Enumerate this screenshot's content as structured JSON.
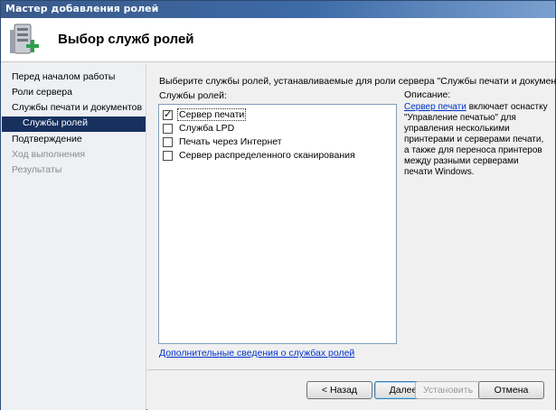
{
  "window": {
    "title": "Мастер добавления ролей"
  },
  "header": {
    "title": "Выбор служб ролей",
    "icon": "server-add-icon"
  },
  "nav": {
    "items": [
      {
        "label": "Перед началом работы",
        "state": "normal"
      },
      {
        "label": "Роли сервера",
        "state": "normal"
      },
      {
        "label": "Службы печати и документов",
        "state": "normal"
      },
      {
        "label": "Службы ролей",
        "state": "active"
      },
      {
        "label": "Подтверждение",
        "state": "normal"
      },
      {
        "label": "Ход выполнения",
        "state": "disabled"
      },
      {
        "label": "Результаты",
        "state": "disabled"
      }
    ]
  },
  "main": {
    "prompt": "Выберите службы ролей, устанавливаемые для роли сервера \"Службы печати и документов\":",
    "roles_label": "Службы ролей:",
    "roles": [
      {
        "label": "Сервер печати",
        "checked": true
      },
      {
        "label": "Служба LPD",
        "checked": false
      },
      {
        "label": "Печать через Интернет",
        "checked": false
      },
      {
        "label": "Сервер распределенного сканирования",
        "checked": false
      }
    ],
    "description_title": "Описание:",
    "description_link": "Сервер печати",
    "description_text": " включает оснастку \"Управление печатью\" для управления несколькими принтерами и серверами печати, а также для переноса принтеров между разными серверами печати Windows.",
    "more_link": "Дополнительные сведения о службах ролей"
  },
  "buttons": {
    "back": "< Назад",
    "next": "Далее >",
    "install": "Установить",
    "cancel": "Отмена"
  },
  "colors": {
    "active_nav": "#17305e",
    "link": "#0033cc",
    "titlebar": "#3d6aa6"
  }
}
